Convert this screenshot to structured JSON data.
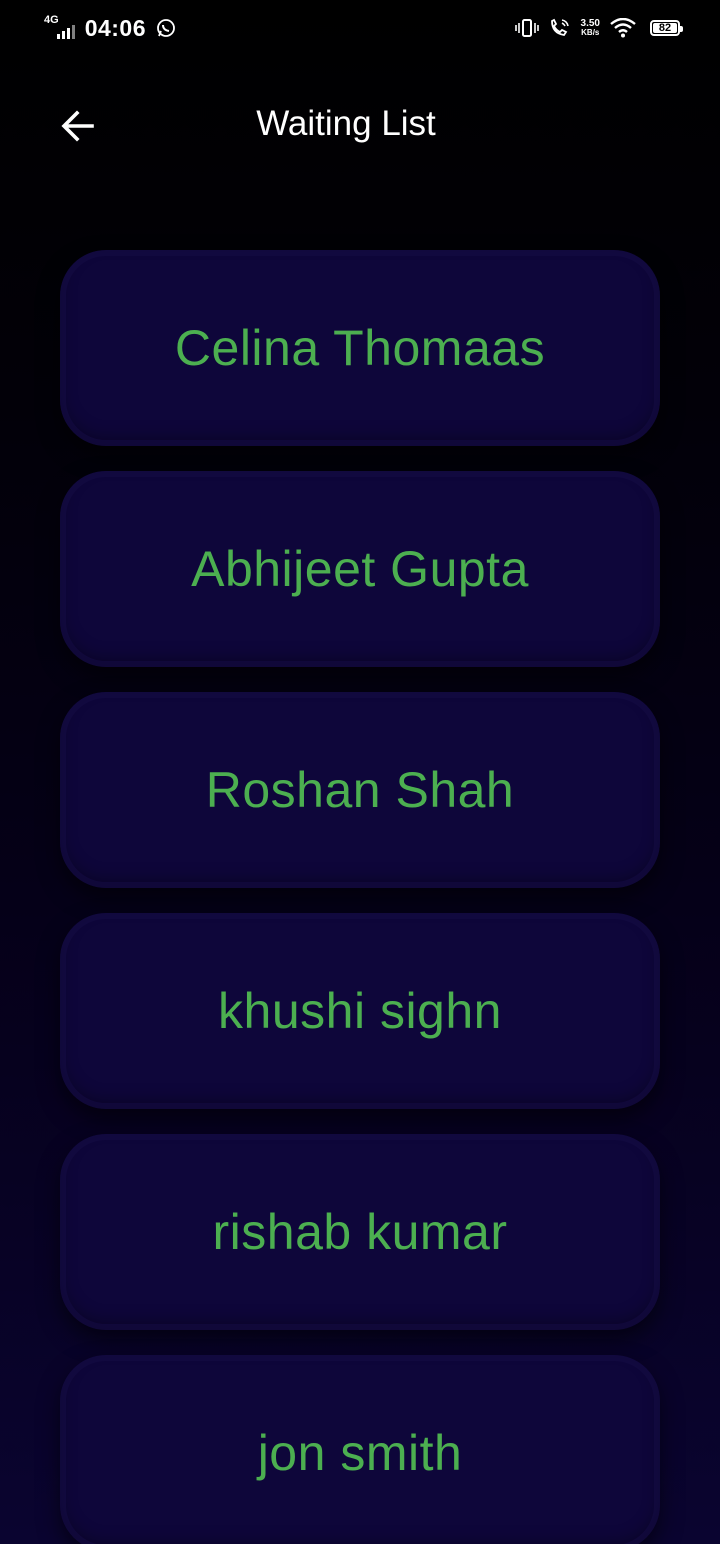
{
  "status_bar": {
    "network": "4G",
    "time": "04:06",
    "speed_value": "3.50",
    "speed_unit": "KB/s",
    "battery": "82"
  },
  "header": {
    "title": "Waiting List",
    "back_icon": "arrow-left-icon"
  },
  "waiting_list": [
    {
      "name": "Celina Thomaas"
    },
    {
      "name": "Abhijeet Gupta"
    },
    {
      "name": "Roshan Shah"
    },
    {
      "name": "khushi sighn"
    },
    {
      "name": "rishab kumar"
    },
    {
      "name": "jon smith"
    }
  ],
  "colors": {
    "name_text": "#4caf50",
    "card_bg": "#0e063a",
    "background_top": "#000000",
    "background_bottom": "#0a0430"
  }
}
